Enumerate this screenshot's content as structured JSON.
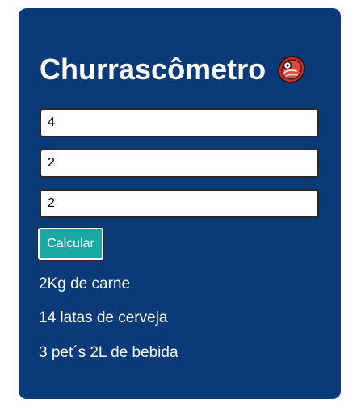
{
  "app": {
    "title": "Churrascômetro",
    "title_icon": "meat-icon"
  },
  "form": {
    "fields": [
      {
        "value": "4"
      },
      {
        "value": "2"
      },
      {
        "value": "2"
      }
    ],
    "calculate_label": "Calcular"
  },
  "results": [
    "2Kg de carne",
    "14 latas de cerveja",
    "3 pet´s 2L de bebida"
  ],
  "colors": {
    "card_background": "#0a3a78",
    "button_background": "#1aa8a2",
    "text": "#ffffff"
  }
}
